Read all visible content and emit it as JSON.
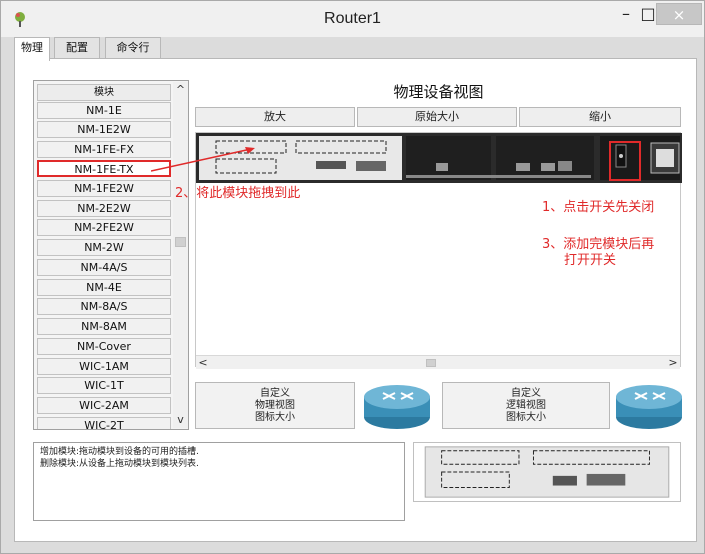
{
  "window": {
    "title": "Router1",
    "minimize": "–",
    "maximize": "□",
    "close": "×"
  },
  "tabs": [
    {
      "label": "物理",
      "active": true
    },
    {
      "label": "配置",
      "active": false
    },
    {
      "label": "命令行",
      "active": false
    }
  ],
  "module_list": {
    "header": "模块",
    "items": [
      "NM-1E",
      "NM-1E2W",
      "NM-1FE-FX",
      "NM-1FE-TX",
      "NM-1FE2W",
      "NM-2E2W",
      "NM-2FE2W",
      "NM-2W",
      "NM-4A/S",
      "NM-4E",
      "NM-8A/S",
      "NM-8AM",
      "NM-Cover",
      "WIC-1AM",
      "WIC-1T",
      "WIC-2AM",
      "WIC-2T"
    ],
    "highlighted": "NM-1FE-TX",
    "scroll_up": "^",
    "scroll_down": "v"
  },
  "physical_view": {
    "title": "物理设备视图",
    "zoom_in": "放大",
    "original_size": "原始大小",
    "zoom_out": "缩小",
    "scroll_left": "<",
    "scroll_right": ">"
  },
  "annotations": {
    "drag_module": "2、将此模块拖拽到此",
    "turn_off": "1、点击开关先关闭",
    "turn_on_line1": "3、添加完模块后再",
    "turn_on_line2": "打开开关"
  },
  "icon_buttons": {
    "physical_custom": [
      "自定义",
      "物理视图",
      "图标大小"
    ],
    "logical_custom": [
      "自定义",
      "逻辑视图",
      "图标大小"
    ]
  },
  "info": {
    "line1": "增加模块:拖动模块到设备的可用的插槽.",
    "line2": "删除模块:从设备上拖动模块到模块列表."
  },
  "colors": {
    "annotation": "#e02a2a",
    "router_body": "#2f2f2f",
    "router_icon": "#3a8fb7"
  }
}
